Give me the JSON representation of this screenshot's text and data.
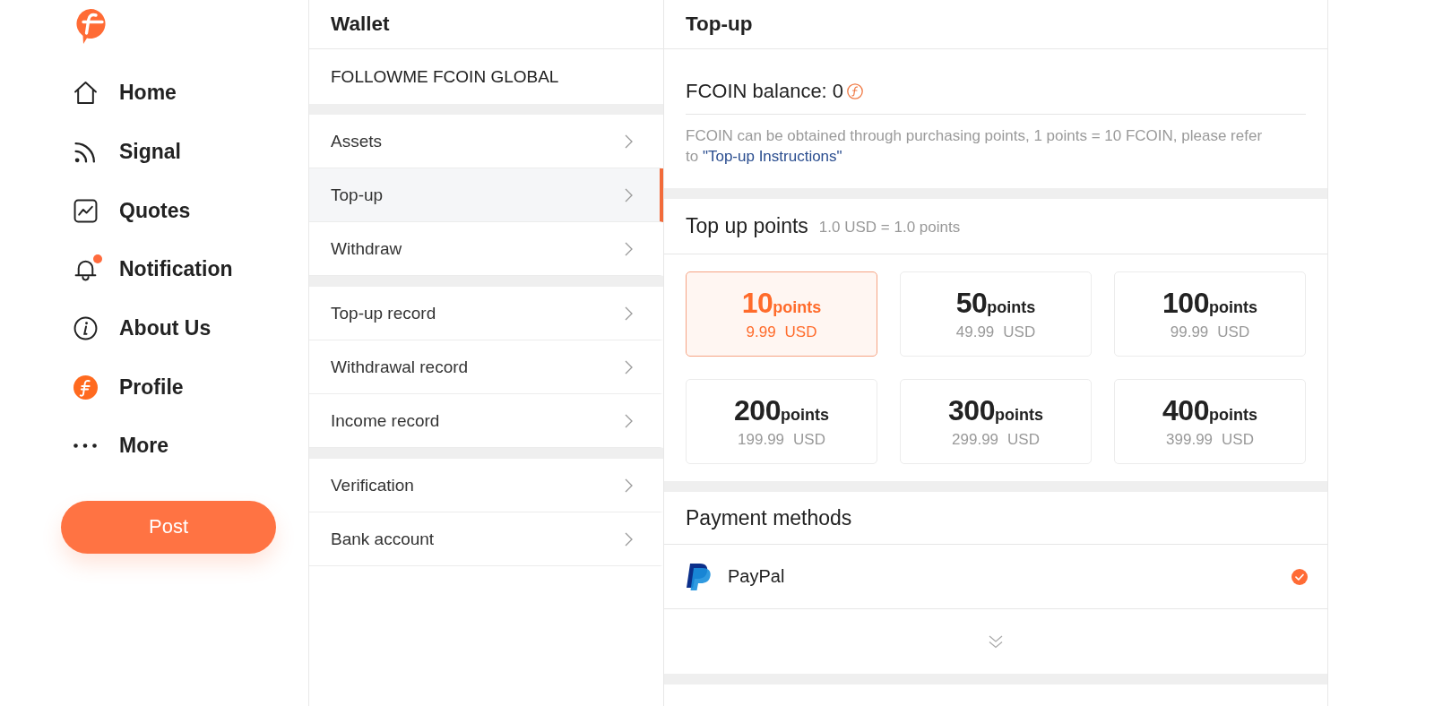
{
  "sidebar": {
    "nav": [
      {
        "label": "Home",
        "dot": false
      },
      {
        "label": "Signal",
        "dot": false
      },
      {
        "label": "Quotes",
        "dot": false
      },
      {
        "label": "Notification",
        "dot": true
      },
      {
        "label": "About Us",
        "dot": false
      },
      {
        "label": "Profile",
        "dot": false
      },
      {
        "label": "More",
        "dot": false
      }
    ],
    "post_button": "Post"
  },
  "wallet": {
    "title": "Wallet",
    "account": "FOLLOWME FCOIN GLOBAL",
    "groups": [
      {
        "items": [
          {
            "label": "Assets",
            "selected": false
          },
          {
            "label": "Top-up",
            "selected": true
          },
          {
            "label": "Withdraw",
            "selected": false
          }
        ]
      },
      {
        "items": [
          {
            "label": "Top-up record",
            "selected": false
          },
          {
            "label": "Withdrawal record",
            "selected": false
          },
          {
            "label": "Income record",
            "selected": false
          }
        ]
      },
      {
        "items": [
          {
            "label": "Verification",
            "selected": false
          },
          {
            "label": "Bank account",
            "selected": false
          }
        ]
      }
    ]
  },
  "topup": {
    "title": "Top-up",
    "balance": "FCOIN balance: 0",
    "note": "FCOIN can be obtained through purchasing points, 1 points = 10 FCOIN, please refer to",
    "note_link": "\"Top-up Instructions\"",
    "points_title": "Top up points",
    "rate": "1.0 USD = 1.0 points",
    "packages": [
      {
        "amount": "10",
        "unit": "points",
        "price": "9.99",
        "currency": "USD",
        "selected": true
      },
      {
        "amount": "50",
        "unit": "points",
        "price": "49.99",
        "currency": "USD",
        "selected": false
      },
      {
        "amount": "100",
        "unit": "points",
        "price": "99.99",
        "currency": "USD",
        "selected": false
      },
      {
        "amount": "200",
        "unit": "points",
        "price": "199.99",
        "currency": "USD",
        "selected": false
      },
      {
        "amount": "300",
        "unit": "points",
        "price": "299.99",
        "currency": "USD",
        "selected": false
      },
      {
        "amount": "400",
        "unit": "points",
        "price": "399.99",
        "currency": "USD",
        "selected": false
      }
    ],
    "payment_title": "Payment methods",
    "payment_methods": [
      {
        "name": "PayPal",
        "selected": true
      }
    ]
  }
}
